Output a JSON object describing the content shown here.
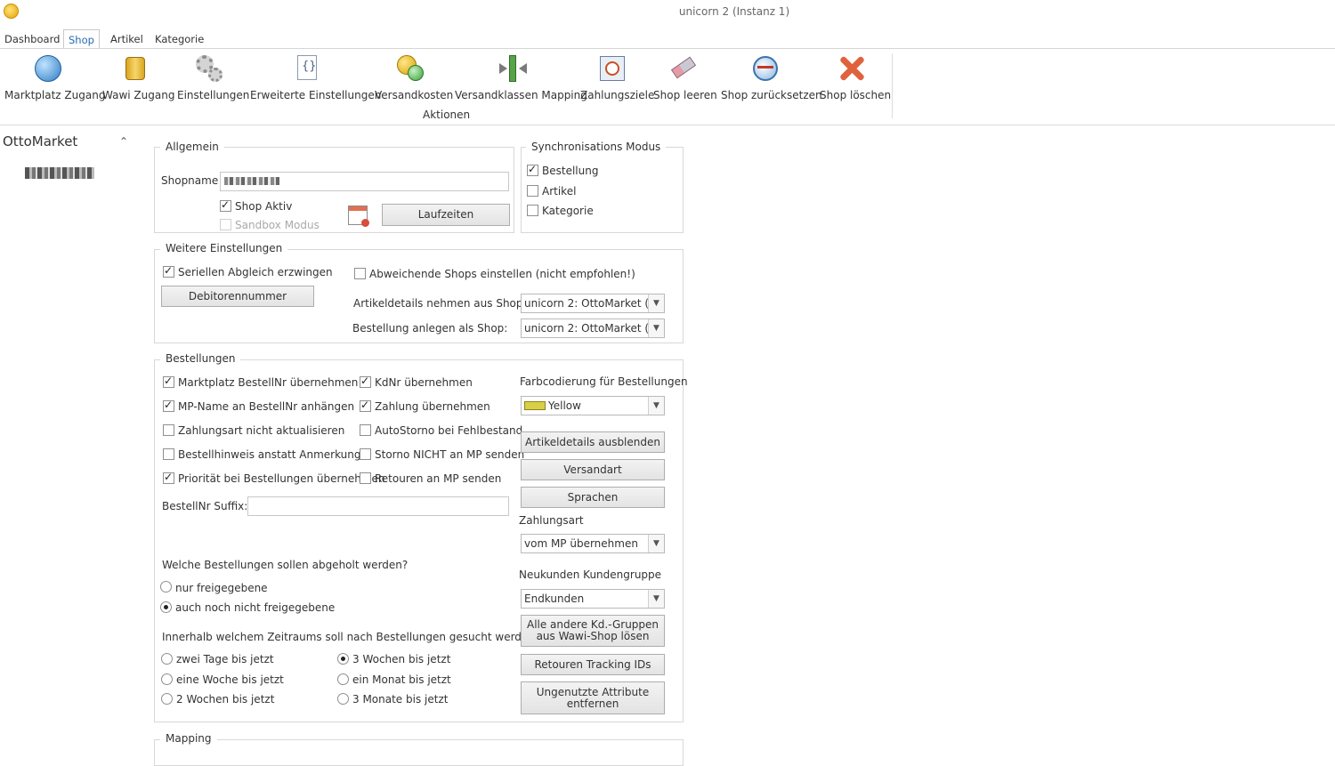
{
  "window": {
    "title": "unicorn 2 (Instanz 1)"
  },
  "menu": {
    "tabs": [
      "Dashboard",
      "Shop",
      "Artikel",
      "Kategorie"
    ],
    "active": "Shop"
  },
  "ribbon": {
    "buttons": [
      "Marktplatz Zugang",
      "Wawi Zugang",
      "Einstellungen",
      "Erweiterte Einstellungen",
      "Versandkosten",
      "Versandklassen Mapping",
      "Zahlungsziele",
      "Shop leeren",
      "Shop zurücksetzen",
      "Shop löschen"
    ],
    "group_caption": "Aktionen"
  },
  "sidebar": {
    "title": "OttoMarket",
    "chevron": "^"
  },
  "allgemein": {
    "caption": "Allgemein",
    "shopname_label": "Shopname",
    "shop_aktiv": "Shop Aktiv",
    "sandbox": "Sandbox Modus",
    "laufzeiten": "Laufzeiten"
  },
  "sync": {
    "caption": "Synchronisations Modus",
    "bestellung": "Bestellung",
    "artikel": "Artikel",
    "kategorie": "Kategorie"
  },
  "weitere": {
    "caption": "Weitere Einstellungen",
    "seriellen": "Seriellen Abgleich erzwingen",
    "abweichende": "Abweichende Shops einstellen (nicht empfohlen!)",
    "debitoren": "Debitorennummer",
    "artikeldetails_label": "Artikeldetails nehmen aus Shop:",
    "artikeldetails_value": "unicorn 2: OttoMarket (...",
    "bestellung_label": "Bestellung anlegen als Shop:",
    "bestellung_value": "unicorn 2: OttoMarket (..."
  },
  "bestellungen": {
    "caption": "Bestellungen",
    "left": [
      "Marktplatz BestellNr übernehmen",
      "MP-Name an BestellNr anhängen",
      "Zahlungsart nicht aktualisieren",
      "Bestellhinweis anstatt Anmerkung",
      "Priorität bei Bestellungen übernehmen"
    ],
    "right": [
      "KdNr übernehmen",
      "Zahlung übernehmen",
      "AutoStorno bei Fehlbestand",
      "Storno NICHT an MP senden",
      "Retouren an MP senden"
    ],
    "suffix_label": "BestellNr Suffix:",
    "welche_label": "Welche Bestellungen sollen abgeholt werden?",
    "welche_options": [
      "nur freigegebene",
      "auch noch nicht freigegebene"
    ],
    "zeitraum_label": "Innerhalb welchem Zeitraums soll nach Bestellungen gesucht werden?",
    "zeitraum_options": [
      "zwei Tage bis jetzt",
      "eine Woche bis jetzt",
      "2 Wochen bis jetzt",
      "3 Wochen bis jetzt",
      "ein Monat bis jetzt",
      "3 Monate bis jetzt"
    ],
    "farb_label": "Farbcodierung für Bestellungen",
    "farb_value": "Yellow",
    "farb_color": "#d8cf46",
    "btn_artikeldetails": "Artikeldetails ausblenden",
    "btn_versandart": "Versandart",
    "btn_sprachen": "Sprachen",
    "zahlungsart_label": "Zahlungsart",
    "zahlungsart_value": "vom MP übernehmen",
    "neukunden_label": "Neukunden Kundengruppe",
    "neukunden_value": "Endkunden",
    "btn_kdgruppen_1": "Alle andere Kd.-Gruppen",
    "btn_kdgruppen_2": "aus Wawi-Shop lösen",
    "btn_retouren": "Retouren Tracking IDs",
    "btn_attribute_1": "Ungenutzte Attribute",
    "btn_attribute_2": "entfernen"
  },
  "mapping": {
    "caption": "Mapping"
  }
}
